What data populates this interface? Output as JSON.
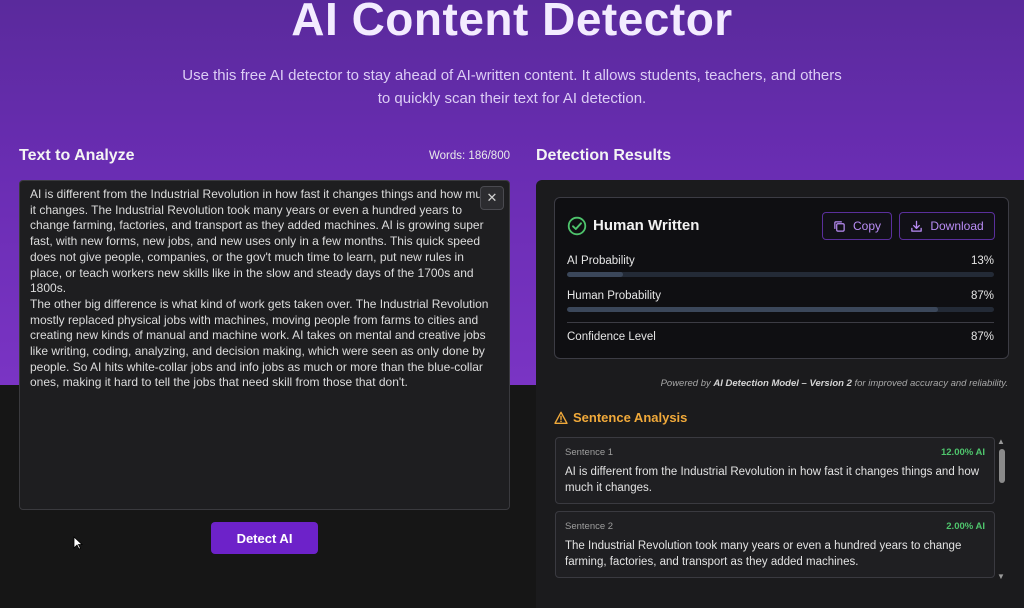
{
  "hero": {
    "title": "AI Content Detector",
    "subtitle": "Use this free AI detector to stay ahead of AI-written content. It allows students, teachers, and others to quickly scan their text for AI detection."
  },
  "input": {
    "heading": "Text to Analyze",
    "word_count": "Words: 186/800",
    "paragraphs": [
      "AI is different from the Industrial Revolution in how fast it changes things and how much it changes. The Industrial Revolution took many years or even a hundred years to change farming, factories, and transport as they added machines. AI is growing super fast, with new forms, new jobs, and new uses only in a few months. This quick speed does not give people, companies, or the gov't much time to learn, put new rules in place, or teach workers new skills like in the slow and steady days of the 1700s and 1800s.",
      "The other big difference is what kind of work gets taken over. The Industrial Revolution mostly replaced physical jobs with machines, moving people from farms to cities and creating new kinds of manual and machine work. AI takes on mental and creative jobs like writing, coding, analyzing, and decision making, which were seen as only done by people. So AI hits white-collar jobs and info jobs as much or more than the blue-collar ones, making it hard to tell the jobs that need skill from those that don't."
    ],
    "clear_icon": "close-icon",
    "detect_label": "Detect AI"
  },
  "results": {
    "heading": "Detection Results",
    "status": "Human Written",
    "status_icon": "check-circle-icon",
    "copy_label": "Copy",
    "download_label": "Download",
    "metrics": [
      {
        "label": "AI Probability",
        "value": "13%",
        "fraction": 0.13
      },
      {
        "label": "Human Probability",
        "value": "87%",
        "fraction": 0.87
      },
      {
        "label": "Confidence Level",
        "value": "87%"
      }
    ],
    "powered_prefix": "Powered by ",
    "powered_model": "AI Detection Model – Version 2",
    "powered_suffix": " for improved accuracy and reliability."
  },
  "sentence_analysis": {
    "heading": "Sentence Analysis",
    "icon": "warning-icon",
    "sentences": [
      {
        "label": "Sentence 1",
        "score": "12.00% AI",
        "text": "AI is different from the Industrial Revolution in how fast it changes things and how much it changes."
      },
      {
        "label": "Sentence 2",
        "score": "2.00% AI",
        "text": "The Industrial Revolution took many years or even a hundred years to change farming, factories, and transport as they added machines."
      }
    ]
  },
  "colors": {
    "accent": "#6d22c9",
    "success": "#4ec46c",
    "warning": "#f0a93a"
  }
}
